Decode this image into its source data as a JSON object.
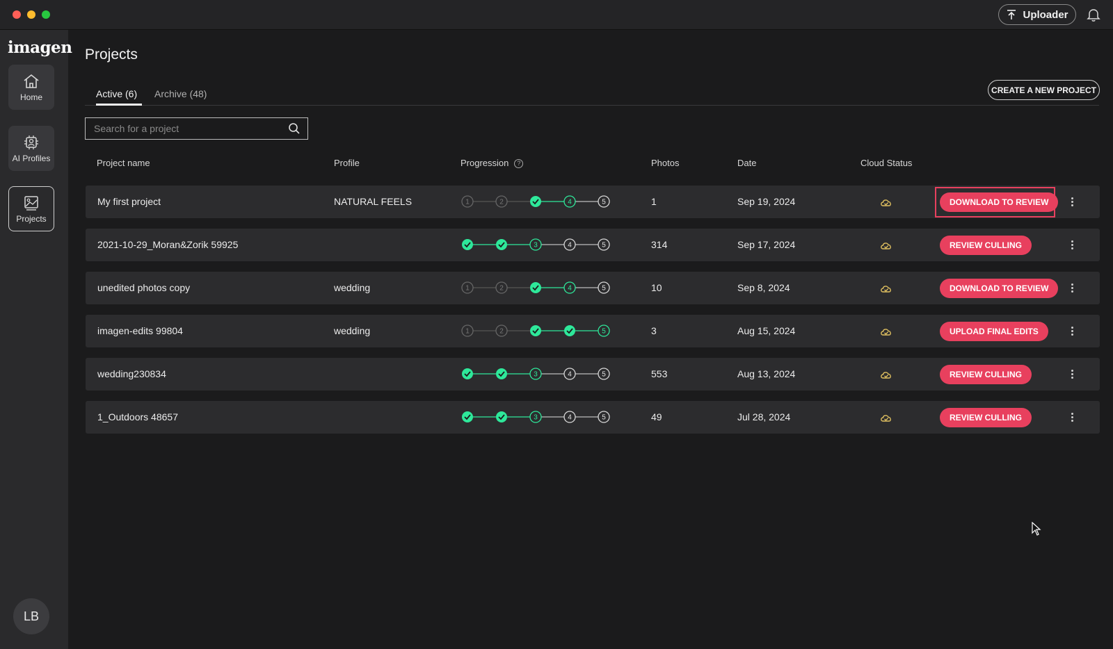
{
  "titlebar": {
    "uploader_label": "Uploader"
  },
  "sidebar": {
    "logo": "imagen",
    "items": [
      {
        "label": "Home",
        "icon": "home-icon"
      },
      {
        "label": "AI Profiles",
        "icon": "ai-profiles-icon"
      },
      {
        "label": "Projects",
        "icon": "projects-icon",
        "active": true
      }
    ],
    "avatar_initials": "LB"
  },
  "main": {
    "title": "Projects",
    "tabs": [
      {
        "label": "Active (6)",
        "active": true
      },
      {
        "label": "Archive (48)"
      }
    ],
    "create_button": "CREATE A NEW PROJECT",
    "search": {
      "placeholder": "Search for a project",
      "value": ""
    },
    "columns": [
      "Project name",
      "Profile",
      "Progression",
      "Photos",
      "Date",
      "Cloud Status"
    ],
    "rows": [
      {
        "name": "My first project",
        "profile": "NATURAL FEELS",
        "progression": [
          "skipped",
          "skipped",
          "done",
          "current",
          "pending"
        ],
        "photos": "1",
        "date": "Sep 19, 2024",
        "action": "DOWNLOAD TO REVIEW",
        "highlighted": true
      },
      {
        "name": "2021-10-29_Moran&Zorik 59925",
        "profile": "",
        "progression": [
          "done",
          "done",
          "current",
          "pending",
          "pending"
        ],
        "photos": "314",
        "date": "Sep 17, 2024",
        "action": "REVIEW CULLING"
      },
      {
        "name": "unedited photos copy",
        "profile": "wedding",
        "progression": [
          "skipped",
          "skipped",
          "done",
          "current",
          "pending"
        ],
        "photos": "10",
        "date": "Sep 8, 2024",
        "action": "DOWNLOAD TO REVIEW"
      },
      {
        "name": "imagen-edits 99804",
        "profile": "wedding",
        "progression": [
          "skipped",
          "skipped",
          "done",
          "done",
          "current"
        ],
        "photos": "3",
        "date": "Aug 15, 2024",
        "action": "UPLOAD FINAL EDITS"
      },
      {
        "name": "wedding230834",
        "profile": "",
        "progression": [
          "done",
          "done",
          "current",
          "pending",
          "pending"
        ],
        "photos": "553",
        "date": "Aug 13, 2024",
        "action": "REVIEW CULLING"
      },
      {
        "name": "1_Outdoors 48657",
        "profile": "",
        "progression": [
          "done",
          "done",
          "current",
          "pending",
          "pending"
        ],
        "photos": "49",
        "date": "Jul 28, 2024",
        "action": "REVIEW CULLING"
      }
    ],
    "cloud_icon": "cloud-check-icon"
  },
  "colors": {
    "accent": "#e8405e",
    "progress_done": "#2ee89a",
    "background": "#1b1b1c",
    "row": "#2c2c2e",
    "cloud": "#e0c060"
  }
}
